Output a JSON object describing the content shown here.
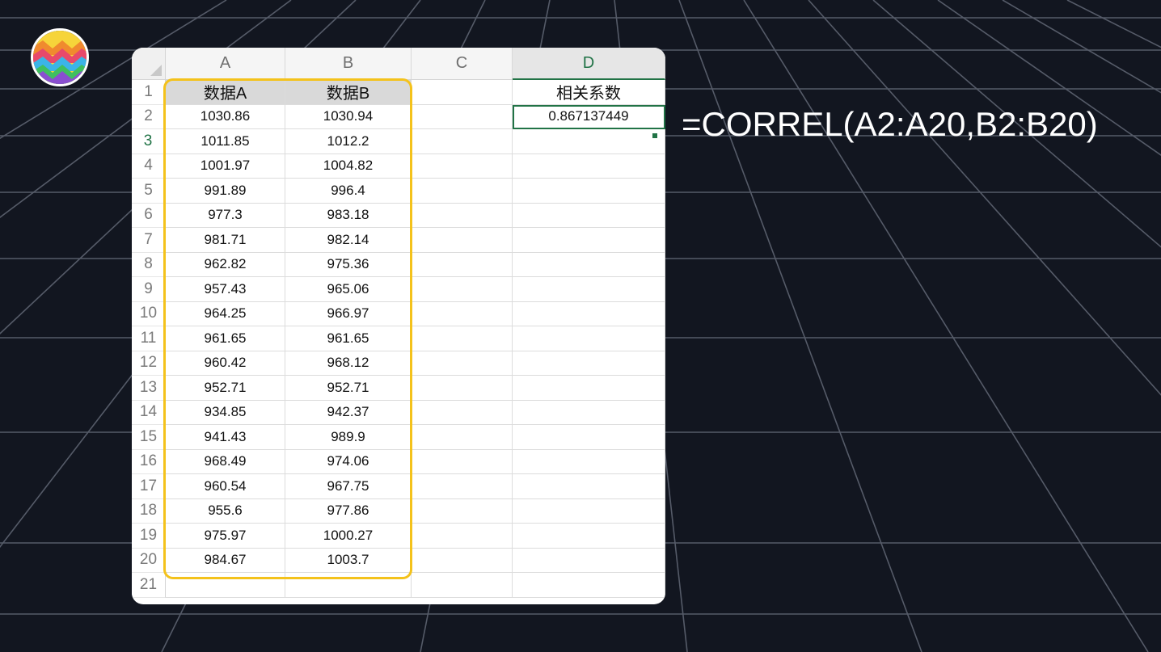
{
  "logo": {
    "icon": "colorful-zigzag-logo-icon"
  },
  "sheet": {
    "columns": [
      "A",
      "B",
      "C",
      "D"
    ],
    "selected_column": "D",
    "selected_row": "3",
    "rows": [
      "1",
      "2",
      "3",
      "4",
      "5",
      "6",
      "7",
      "8",
      "9",
      "10",
      "11",
      "12",
      "13",
      "14",
      "15",
      "16",
      "17",
      "18",
      "19",
      "20",
      "21"
    ],
    "header_a": "数据A",
    "header_b": "数据B",
    "header_d": "相关系数",
    "result_d2": "0.867137449",
    "data_a": [
      "1030.86",
      "1011.85",
      "1001.97",
      "991.89",
      "977.3",
      "981.71",
      "962.82",
      "957.43",
      "964.25",
      "961.65",
      "960.42",
      "952.71",
      "934.85",
      "941.43",
      "968.49",
      "960.54",
      "955.6",
      "975.97",
      "984.67"
    ],
    "data_b": [
      "1030.94",
      "1012.2",
      "1004.82",
      "996.4",
      "983.18",
      "982.14",
      "975.36",
      "965.06",
      "966.97",
      "961.65",
      "968.12",
      "952.71",
      "942.37",
      "989.9",
      "974.06",
      "967.75",
      "977.86",
      "1000.27",
      "1003.7"
    ]
  },
  "formula": "=CORREL(A2:A20,B2:B20)",
  "colors": {
    "highlight": "#f4c21b",
    "accent": "#217346",
    "background": "#121620"
  }
}
